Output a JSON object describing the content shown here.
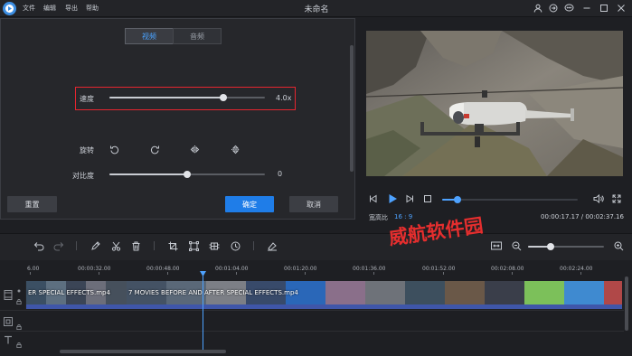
{
  "app": {
    "title": "未命名",
    "menu": [
      "文件",
      "编辑",
      "导出",
      "帮助"
    ]
  },
  "window_icons": [
    "user-icon",
    "sign-in-icon",
    "chat-icon",
    "minimize-icon",
    "maximize-icon",
    "close-icon"
  ],
  "panel": {
    "tabs": [
      {
        "label": "视频",
        "active": true
      },
      {
        "label": "音频",
        "active": false
      }
    ],
    "speed": {
      "label": "速度",
      "value_text": "4.0x",
      "level": 0.73
    },
    "rotate": {
      "label": "旋转",
      "icons": [
        "rotate-left-icon",
        "rotate-right-icon",
        "flip-horizontal-icon",
        "flip-vertical-icon"
      ]
    },
    "contrast": {
      "label": "对比度",
      "value_text": "0",
      "level": 0.5
    },
    "buttons": {
      "reset": "重置",
      "ok": "确定",
      "cancel": "取消"
    }
  },
  "player": {
    "aspect_label": "宽高比",
    "aspect_value": "16 : 9",
    "time": "00:00:17.17 / 00:02:37.16",
    "progress": 0.11
  },
  "timeline": {
    "ticks": [
      "6.00",
      "00:00:32.00",
      "00:00:48.00",
      "00:01:04.00",
      "00:01:20.00",
      "00:01:36.00",
      "00:01:52.00",
      "00:02:08.00",
      "00:02:24.00"
    ],
    "clips": [
      {
        "title": "ER SPECIAL EFFECTS.mp4"
      },
      {
        "title": "7 MOVIES BEFORE AND AFTER SPECIAL EFFECTS.mp4"
      }
    ],
    "zoom_level": 0.3
  },
  "watermark": "威航软件园",
  "colors": {
    "accent": "#1f7de8",
    "highlight_border": "#e5252f",
    "clip_bar": "#3f56a9",
    "watermark": "#e52e2e"
  }
}
